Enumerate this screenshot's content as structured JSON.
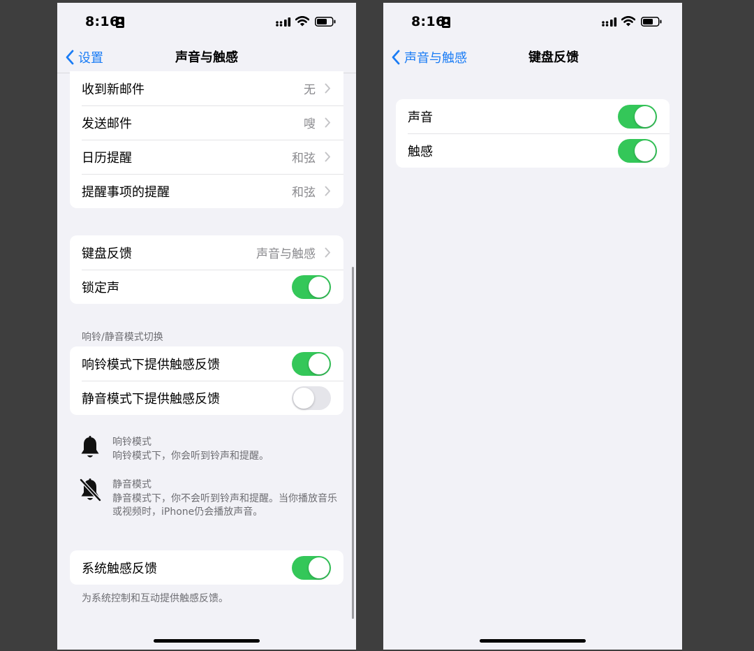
{
  "left_screen": {
    "status": {
      "time": "8:16"
    },
    "nav": {
      "back_label": "设置",
      "title": "声音与触感"
    },
    "alert_rows": [
      {
        "label": "收到新邮件",
        "value": "无"
      },
      {
        "label": "发送邮件",
        "value": "嗖"
      },
      {
        "label": "日历提醒",
        "value": "和弦"
      },
      {
        "label": "提醒事项的提醒",
        "value": "和弦"
      }
    ],
    "feedback_group": {
      "keyboard_label": "键盘反馈",
      "keyboard_value": "声音与触感",
      "lock_label": "锁定声",
      "lock_on": true
    },
    "ring_silent": {
      "header": "响铃/静音模式切换",
      "ring_label": "响铃模式下提供触感反馈",
      "ring_on": true,
      "silent_label": "静音模式下提供触感反馈",
      "silent_on": false
    },
    "modes": [
      {
        "icon": "bell-icon",
        "title": "响铃模式",
        "desc": "响铃模式下，你会听到铃声和提醒。"
      },
      {
        "icon": "bell-slash-icon",
        "title": "静音模式",
        "desc": "静音模式下，你不会听到铃声和提醒。当你播放音乐或视频时，iPhone仍会播放声音。"
      }
    ],
    "system_haptics": {
      "label": "系统触感反馈",
      "on": true,
      "footer": "为系统控制和互动提供触感反馈。"
    }
  },
  "right_screen": {
    "status": {
      "time": "8:16"
    },
    "nav": {
      "back_label": "声音与触感",
      "title": "键盘反馈"
    },
    "rows": [
      {
        "label": "声音",
        "on": true
      },
      {
        "label": "触感",
        "on": true
      }
    ]
  },
  "colors": {
    "accent": "#1a7cf5",
    "toggle_on": "#34c759",
    "toggle_off": "#e5e5ea",
    "background": "#f2f2f7",
    "outer_background": "#3e3e3e",
    "secondary_text": "#8a8a8e"
  }
}
